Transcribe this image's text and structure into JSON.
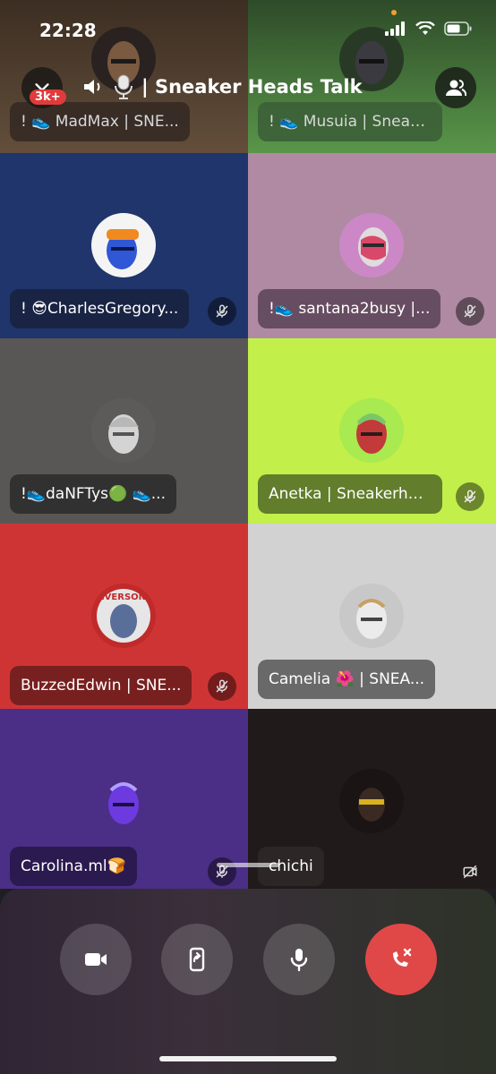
{
  "status_bar": {
    "time": "22:28"
  },
  "header": {
    "notification_badge": "3k+",
    "channel_name": "| Sneaker Heads Talk",
    "icons": [
      "chevron-down-icon",
      "speaker-icon",
      "microphone-icon",
      "members-icon"
    ]
  },
  "participants": [
    {
      "name": "! 👟 MadMax | SNE...",
      "bg": "#4a3b2e",
      "muted": false
    },
    {
      "name": "! 👟 Musuia | Sneak...",
      "bg": "#3f6b35",
      "muted": false
    },
    {
      "name": "! 😎CharlesGregory...",
      "bg": "#1f356b",
      "muted": true
    },
    {
      "name": "!👟 santana2busy |...",
      "bg": "#b08aa3",
      "muted": true
    },
    {
      "name": "!👟daNFTys🟢 👟...",
      "bg": "#585756",
      "muted": false
    },
    {
      "name": "Anetka | Sneakerhe...",
      "bg": "#c2ef4a",
      "muted": true
    },
    {
      "name": "BuzzedEdwin | SNE...",
      "bg": "#cf3434",
      "muted": true
    },
    {
      "name": "Camelia 🌺 | SNEA...",
      "bg": "#d2d2d2",
      "muted": false
    },
    {
      "name": "Carolina.ml🍞",
      "bg": "#4b2e86",
      "muted": true
    },
    {
      "name": "chichi",
      "bg": "#211a1a",
      "muted": false,
      "video_off": true
    }
  ],
  "controls": {
    "icons": [
      "camera-icon",
      "screen-share-icon",
      "microphone-icon",
      "end-call-icon"
    ],
    "end_color": "#e04848"
  },
  "colors": {
    "accent": "#e03b3b"
  }
}
